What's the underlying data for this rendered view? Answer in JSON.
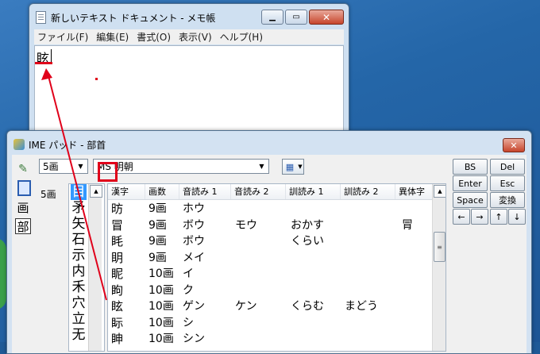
{
  "notepad": {
    "title": "新しいテキスト ドキュメント - メモ帳",
    "menu": [
      "ファイル(F)",
      "編集(E)",
      "書式(O)",
      "表示(V)",
      "ヘルプ(H)"
    ],
    "content": "眩"
  },
  "ime_pad": {
    "title": "IME パッド - 部首",
    "stroke_select": "5画",
    "font_select": "MS 明朝",
    "stroke_label": "5画",
    "radicals": [
      "目",
      "矛",
      "矢",
      "石",
      "示",
      "内",
      "禾",
      "穴",
      "立",
      "无"
    ],
    "selected_radical": "目",
    "columns": [
      "漢字",
      "画数",
      "音読み 1",
      "音読み 2",
      "訓読み 1",
      "訓読み 2",
      "異体字"
    ],
    "rows": [
      [
        "昉",
        "9画",
        "ホウ",
        "",
        "",
        "",
        ""
      ],
      [
        "冒",
        "9画",
        "ボウ",
        "モウ",
        "おかす",
        "",
        "冐"
      ],
      [
        "眊",
        "9画",
        "ボウ",
        "",
        "くらい",
        "",
        ""
      ],
      [
        "眀",
        "9画",
        "メイ",
        "",
        "",
        "",
        ""
      ],
      [
        "眤",
        "10画",
        "イ",
        "",
        "",
        "",
        ""
      ],
      [
        "眗",
        "10画",
        "ク",
        "",
        "",
        "",
        ""
      ],
      [
        "眩",
        "10画",
        "ゲン",
        "ケン",
        "くらむ",
        "まどう",
        ""
      ],
      [
        "眎",
        "10画",
        "シ",
        "",
        "",
        "",
        ""
      ],
      [
        "眒",
        "10画",
        "シン",
        "",
        "",
        "",
        ""
      ]
    ],
    "keys": {
      "bs": "BS",
      "del": "Del",
      "enter": "Enter",
      "esc": "Esc",
      "space": "Space",
      "convert": "変換",
      "left": "←",
      "right": "→",
      "up": "↑",
      "down": "↓"
    }
  },
  "colors": {
    "highlight": "#e0001a",
    "selection": "#3399ff"
  }
}
